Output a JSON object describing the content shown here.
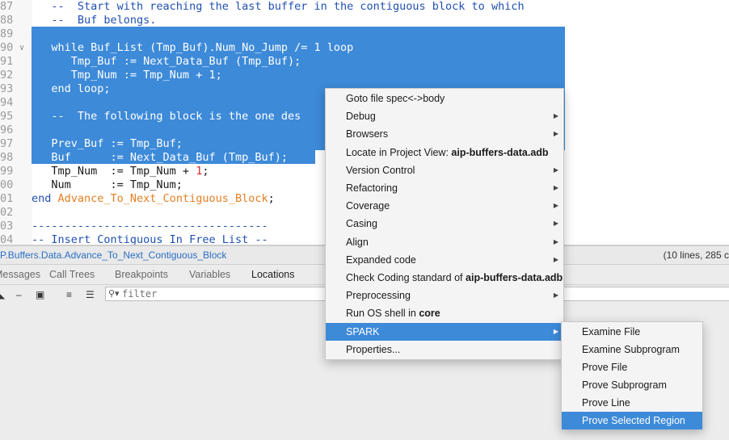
{
  "editor": {
    "lines": [
      {
        "num": "87",
        "parts": [
          {
            "t": "   --  Start with reaching the last buffer in the contiguous block to which",
            "c": "cmt"
          }
        ]
      },
      {
        "num": "88",
        "parts": [
          {
            "t": "   --  Buf belongs.",
            "c": "cmt"
          }
        ]
      },
      {
        "num": "89",
        "parts": [
          {
            "t": "",
            "c": ""
          }
        ]
      },
      {
        "num": "90",
        "parts": [
          {
            "t": "   while Buf_List (Tmp_Buf).Num_No_Jump /= 1 loop",
            "c": "white"
          }
        ]
      },
      {
        "num": "91",
        "parts": [
          {
            "t": "      Tmp_Buf := Next_Data_Buf (Tmp_Buf);",
            "c": "white"
          }
        ]
      },
      {
        "num": "92",
        "parts": [
          {
            "t": "      Tmp_Num := Tmp_Num + 1;",
            "c": "white"
          }
        ]
      },
      {
        "num": "93",
        "parts": [
          {
            "t": "   end loop;",
            "c": "white"
          }
        ]
      },
      {
        "num": "94",
        "parts": [
          {
            "t": "",
            "c": ""
          }
        ]
      },
      {
        "num": "95",
        "parts": [
          {
            "t": "   --  The following block is the one des",
            "c": "white"
          }
        ]
      },
      {
        "num": "96",
        "parts": [
          {
            "t": "",
            "c": ""
          }
        ]
      },
      {
        "num": "97",
        "parts": [
          {
            "t": "   Prev_Buf := Tmp_Buf;",
            "c": "white"
          }
        ]
      },
      {
        "num": "98",
        "parts": [
          {
            "t": "   Buf      := Next_Data_Buf (Tmp_Buf);",
            "c": "white"
          }
        ]
      },
      {
        "num": "99",
        "parts": [
          {
            "t": "   Tmp_Num  := Tmp_Num + ",
            "c": ""
          },
          {
            "t": "1",
            "c": "red"
          },
          {
            "t": ";",
            "c": ""
          }
        ]
      },
      {
        "num": "00",
        "parts": [
          {
            "t": "   Num      := Tmp_Num;",
            "c": ""
          }
        ]
      },
      {
        "num": "01",
        "parts": [
          {
            "t": "end ",
            "c": "kw"
          },
          {
            "t": "Advance_To_Next_Contiguous_Block",
            "c": "proc"
          },
          {
            "t": ";",
            "c": ""
          }
        ]
      },
      {
        "num": "02",
        "parts": [
          {
            "t": "",
            "c": ""
          }
        ]
      },
      {
        "num": "03",
        "parts": [
          {
            "t": "------------------------------------",
            "c": "cmt"
          }
        ]
      },
      {
        "num": "04",
        "parts": [
          {
            "t": "-- Insert Contiguous In Free List --",
            "c": "cmt"
          }
        ]
      }
    ]
  },
  "status": {
    "path": "P.Buffers.Data.Advance_To_Next_Contiguous_Block",
    "info": "(10 lines, 285 c"
  },
  "panel": {
    "tabs": [
      "Messages",
      "Call Trees",
      "Breakpoints",
      "Variables",
      "Locations"
    ],
    "active_tab": "Locations",
    "filter_placeholder": "filter"
  },
  "context_menu": {
    "items": [
      {
        "label": "Goto file spec<->body",
        "bold": "",
        "submenu": false
      },
      {
        "label": "Debug",
        "bold": "",
        "submenu": true
      },
      {
        "label": "Browsers",
        "bold": "",
        "submenu": true
      },
      {
        "label": "Locate in Project View: ",
        "bold": "aip-buffers-data.adb",
        "submenu": false
      },
      {
        "label": "Version Control",
        "bold": "",
        "submenu": true
      },
      {
        "label": "Refactoring",
        "bold": "",
        "submenu": true
      },
      {
        "label": "Coverage",
        "bold": "",
        "submenu": true
      },
      {
        "label": "Casing",
        "bold": "",
        "submenu": true
      },
      {
        "label": "Align",
        "bold": "",
        "submenu": true
      },
      {
        "label": "Expanded code",
        "bold": "",
        "submenu": true
      },
      {
        "label": "Check Coding standard of ",
        "bold": "aip-buffers-data.adb",
        "submenu": false
      },
      {
        "label": "Preprocessing",
        "bold": "",
        "submenu": true
      },
      {
        "label": "Run OS shell in ",
        "bold": "core",
        "submenu": false
      },
      {
        "label": "SPARK",
        "bold": "",
        "submenu": true,
        "highlighted": true
      },
      {
        "label": "Properties...",
        "bold": "",
        "submenu": false
      }
    ]
  },
  "spark_submenu": {
    "items": [
      {
        "label": "Examine File"
      },
      {
        "label": "Examine Subprogram"
      },
      {
        "label": "Prove File"
      },
      {
        "label": "Prove Subprogram"
      },
      {
        "label": "Prove Line"
      },
      {
        "label": "Prove Selected Region",
        "highlighted": true
      }
    ]
  }
}
